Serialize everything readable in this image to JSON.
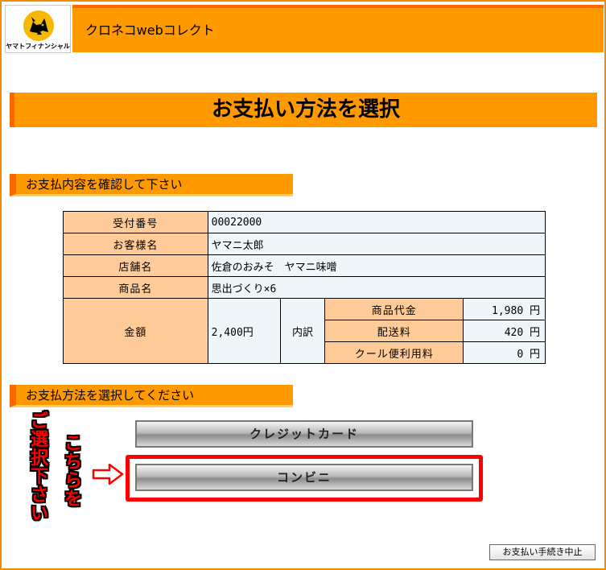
{
  "header": {
    "logo_text": "ヤマトフィナンシャル",
    "app_title": "クロネコwebコレクト"
  },
  "page_title": "お支払い方法を選択",
  "confirm_section": {
    "heading": "お支払内容を確認して下さい",
    "rows": [
      {
        "label": "受付番号",
        "value": "00022000"
      },
      {
        "label": "お客様名",
        "value": "ヤマニ太郎"
      },
      {
        "label": "店舗名",
        "value": "佐倉のおみそ　ヤマニ味噌"
      },
      {
        "label": "商品名",
        "value": "思出づくり×6"
      }
    ],
    "amount": {
      "label": "金額",
      "value": "2,400円",
      "breakdown_label": "内訳",
      "items": [
        {
          "label": "商品代金",
          "value": "1,980 円"
        },
        {
          "label": "配送料",
          "value": "420 円"
        },
        {
          "label": "クール便利用料",
          "value": "0 円"
        }
      ]
    }
  },
  "method_section": {
    "heading": "お支払方法を選択してください",
    "buttons": {
      "credit_card": "クレジットカード",
      "convenience_store": "コンビニ"
    }
  },
  "annotation": {
    "line1": "ご選択下さい",
    "line2": "こちらを"
  },
  "cancel_button": "お支払い手続き中止",
  "colors": {
    "orange": "#ff9900",
    "dark_orange": "#ff6600",
    "label_bg": "#ffcc99",
    "value_bg": "#eef6f9",
    "highlight": "#ff0000"
  }
}
